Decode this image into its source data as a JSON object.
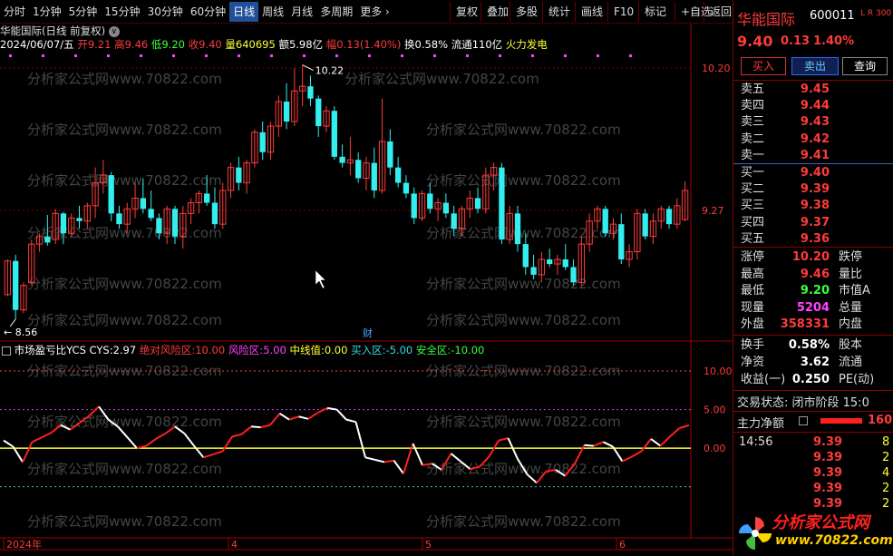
{
  "toolbar": {
    "items": [
      "分时",
      "1分钟",
      "5分钟",
      "15分钟",
      "30分钟",
      "60分钟",
      "日线",
      "周线",
      "月线",
      "多周期",
      "更多 ›"
    ],
    "right_items": [
      "复权",
      "叠加",
      "多股",
      "统计",
      "画线",
      "F10",
      "标记",
      "+自选",
      "返回"
    ]
  },
  "chart_header": {
    "title": "华能国际(日线 前复权)",
    "date": "2024/06/07/五",
    "open_label": "开",
    "open": "9.21",
    "high_label": "高",
    "high": "9.46",
    "low_label": "低",
    "low": "9.20",
    "close_label": "收",
    "close": "9.40",
    "volume_label": "量",
    "volume": "640695",
    "amount_label": "额",
    "amount": "5.98亿",
    "amp_label": "幅",
    "amp": "0.13(1.40%)",
    "turnover_label": "换",
    "turnover": "0.58%",
    "float_label": "流通",
    "float": "110亿",
    "concept": "火力发电"
  },
  "price_axis": {
    "top": "10.20",
    "mid": "9.27"
  },
  "price_annotations": {
    "max": "10.22",
    "min": "8.56",
    "cai": "财"
  },
  "watermark": "分析家公式网www.70822.com",
  "indicator": {
    "name": "市场盈亏比YCS",
    "cys_label": "CYS:",
    "cys": "2.97",
    "abs_risk_label": "绝对风险区:",
    "abs_risk": "10.00",
    "risk_label": "风险区:",
    "risk": "5.00",
    "mid_label": "中线值:",
    "mid": "0.00",
    "buy_label": "买入区:",
    "buy": "-5.00",
    "safe_label": "安全区:",
    "safe": "-10.00",
    "axis": [
      "10.00",
      "5.00",
      "0.00"
    ]
  },
  "time_axis": [
    "2024年",
    "4",
    "5",
    "6"
  ],
  "quote": {
    "name": "华能国际",
    "code": "600011",
    "flags": "L R 300",
    "price": "9.40",
    "change": "0.13",
    "pct": "1.40%",
    "buy_btn": "买入",
    "sell_btn": "卖出",
    "query_btn": "查询",
    "asks": [
      {
        "label": "卖五",
        "price": "9.45"
      },
      {
        "label": "卖四",
        "price": "9.44"
      },
      {
        "label": "卖三",
        "price": "9.43"
      },
      {
        "label": "卖二",
        "price": "9.42"
      },
      {
        "label": "卖一",
        "price": "9.41"
      }
    ],
    "bids": [
      {
        "label": "买一",
        "price": "9.40"
      },
      {
        "label": "买二",
        "price": "9.39"
      },
      {
        "label": "买三",
        "price": "9.38"
      },
      {
        "label": "买四",
        "price": "9.37"
      },
      {
        "label": "买五",
        "price": "9.36"
      }
    ],
    "stats": [
      {
        "label": "涨停",
        "value": "10.20",
        "label2": "跌停"
      },
      {
        "label": "最高",
        "value": "9.46",
        "label2": "量比"
      },
      {
        "label": "最低",
        "value": "9.20",
        "label2": "市值A"
      },
      {
        "label": "现量",
        "value": "5204",
        "label2": "总量"
      },
      {
        "label": "外盘",
        "value": "358331",
        "label2": "内盘"
      }
    ],
    "stats2": [
      {
        "label": "换手",
        "value": "0.58%",
        "label2": "股本"
      },
      {
        "label": "净资",
        "value": "3.62",
        "label2": "流通"
      },
      {
        "label": "收益(一)",
        "value": "0.250",
        "label2": "PE(动)"
      }
    ],
    "trade_status": "交易状态: 闭市阶段 15:0",
    "main_flow_label": "主力净额",
    "main_flow_value": "160",
    "ticks": [
      {
        "time": "14:56",
        "price": "9.39",
        "vol": "8"
      },
      {
        "time": "",
        "price": "9.39",
        "vol": "2"
      },
      {
        "time": "",
        "price": "9.39",
        "vol": "4"
      },
      {
        "time": "",
        "price": "9.39",
        "vol": "2"
      },
      {
        "time": "",
        "price": "9.39",
        "vol": "2"
      }
    ]
  },
  "logo": {
    "text": "分析家公式网",
    "url": "www.70822.com"
  },
  "colors": {
    "up": "#ff3b3b",
    "down": "#33eeee",
    "bg": "#000000",
    "grid": "#880000"
  },
  "chart_data": {
    "type": "candlestick",
    "candles": [
      [
        8.72,
        8.95,
        8.71,
        8.94
      ],
      [
        8.94,
        8.98,
        8.56,
        8.62
      ],
      [
        8.62,
        8.8,
        8.6,
        8.78
      ],
      [
        8.8,
        9.08,
        8.78,
        9.05
      ],
      [
        9.05,
        9.12,
        9.0,
        9.1
      ],
      [
        9.1,
        9.24,
        9.04,
        9.06
      ],
      [
        9.08,
        9.28,
        9.05,
        9.25
      ],
      [
        9.25,
        9.26,
        9.05,
        9.12
      ],
      [
        9.12,
        9.25,
        9.1,
        9.22
      ],
      [
        9.22,
        9.3,
        9.15,
        9.2
      ],
      [
        9.2,
        9.32,
        9.15,
        9.3
      ],
      [
        9.3,
        9.55,
        9.22,
        9.45
      ],
      [
        9.45,
        9.6,
        9.38,
        9.5
      ],
      [
        9.5,
        9.52,
        9.2,
        9.25
      ],
      [
        9.25,
        9.3,
        9.15,
        9.18
      ],
      [
        9.18,
        9.32,
        9.12,
        9.28
      ],
      [
        9.28,
        9.45,
        9.22,
        9.35
      ],
      [
        9.35,
        9.48,
        9.25,
        9.28
      ],
      [
        9.28,
        9.4,
        9.2,
        9.22
      ],
      [
        9.22,
        9.25,
        9.08,
        9.12
      ],
      [
        9.12,
        9.3,
        9.05,
        9.28
      ],
      [
        9.28,
        9.3,
        9.05,
        9.1
      ],
      [
        9.1,
        9.3,
        9.02,
        9.25
      ],
      [
        9.25,
        9.35,
        9.18,
        9.32
      ],
      [
        9.32,
        9.4,
        9.25,
        9.38
      ],
      [
        9.38,
        9.5,
        9.3,
        9.32
      ],
      [
        9.32,
        9.42,
        9.15,
        9.18
      ],
      [
        9.18,
        9.45,
        9.15,
        9.4
      ],
      [
        9.4,
        9.58,
        9.35,
        9.55
      ],
      [
        9.55,
        9.62,
        9.4,
        9.45
      ],
      [
        9.45,
        9.6,
        9.38,
        9.58
      ],
      [
        9.58,
        9.8,
        9.55,
        9.78
      ],
      [
        9.78,
        9.85,
        9.6,
        9.65
      ],
      [
        9.65,
        9.85,
        9.6,
        9.82
      ],
      [
        9.82,
        10.02,
        9.75,
        9.98
      ],
      [
        9.98,
        10.1,
        9.8,
        9.85
      ],
      [
        9.85,
        10.2,
        9.82,
        10.05
      ],
      [
        10.05,
        10.22,
        9.95,
        10.08
      ],
      [
        10.08,
        10.15,
        9.95,
        10.0
      ],
      [
        10.0,
        10.02,
        9.75,
        9.82
      ],
      [
        9.82,
        9.95,
        9.78,
        9.92
      ],
      [
        9.92,
        9.95,
        9.6,
        9.62
      ],
      [
        9.62,
        9.7,
        9.55,
        9.58
      ],
      [
        9.58,
        9.75,
        9.5,
        9.6
      ],
      [
        9.6,
        9.65,
        9.45,
        9.48
      ],
      [
        9.48,
        9.62,
        9.4,
        9.58
      ],
      [
        9.58,
        9.68,
        9.35,
        9.4
      ],
      [
        9.4,
        10.0,
        9.38,
        9.72
      ],
      [
        9.72,
        9.8,
        9.5,
        9.55
      ],
      [
        9.55,
        9.62,
        9.42,
        9.45
      ],
      [
        9.45,
        9.5,
        9.35,
        9.38
      ],
      [
        9.38,
        9.42,
        9.18,
        9.22
      ],
      [
        9.22,
        9.4,
        9.2,
        9.38
      ],
      [
        9.38,
        9.45,
        9.25,
        9.28
      ],
      [
        9.28,
        9.35,
        9.2,
        9.32
      ],
      [
        9.32,
        9.38,
        9.22,
        9.25
      ],
      [
        9.25,
        9.3,
        9.1,
        9.15
      ],
      [
        9.15,
        9.3,
        9.1,
        9.28
      ],
      [
        9.28,
        9.4,
        9.22,
        9.35
      ],
      [
        9.35,
        9.42,
        9.25,
        9.28
      ],
      [
        9.28,
        9.55,
        9.25,
        9.5
      ],
      [
        9.5,
        9.58,
        9.4,
        9.55
      ],
      [
        9.55,
        9.58,
        9.05,
        9.08
      ],
      [
        9.08,
        9.3,
        9.05,
        9.25
      ],
      [
        9.25,
        9.3,
        9.0,
        9.05
      ],
      [
        9.05,
        9.12,
        8.85,
        8.9
      ],
      [
        8.9,
        8.98,
        8.82,
        8.85
      ],
      [
        8.85,
        9.0,
        8.8,
        8.95
      ],
      [
        8.95,
        9.02,
        8.9,
        8.92
      ],
      [
        8.92,
        8.98,
        8.85,
        8.95
      ],
      [
        8.95,
        9.05,
        8.88,
        8.9
      ],
      [
        8.9,
        8.95,
        8.78,
        8.8
      ],
      [
        8.8,
        9.1,
        8.78,
        9.05
      ],
      [
        9.05,
        9.25,
        9.0,
        9.2
      ],
      [
        9.2,
        9.3,
        9.15,
        9.28
      ],
      [
        9.28,
        9.3,
        9.1,
        9.12
      ],
      [
        9.12,
        9.22,
        9.08,
        9.18
      ],
      [
        9.18,
        9.25,
        8.92,
        8.95
      ],
      [
        8.95,
        9.05,
        8.9,
        9.0
      ],
      [
        9.0,
        9.28,
        8.95,
        9.25
      ],
      [
        9.25,
        9.28,
        9.08,
        9.1
      ],
      [
        9.1,
        9.25,
        9.05,
        9.2
      ],
      [
        9.2,
        9.3,
        9.15,
        9.28
      ],
      [
        9.28,
        9.3,
        9.15,
        9.18
      ],
      [
        9.18,
        9.35,
        9.15,
        9.3
      ],
      [
        9.21,
        9.46,
        9.2,
        9.4
      ]
    ],
    "cys_values": [
      1.0,
      0.2,
      -1.8,
      0.8,
      1.4,
      2.0,
      3.0,
      2.4,
      3.3,
      4.2,
      5.4,
      3.7,
      2.8,
      1.4,
      0.0,
      0.3,
      1.2,
      1.9,
      2.8,
      1.9,
      0.3,
      -1.2,
      -0.8,
      -0.4,
      1.5,
      1.8,
      2.8,
      2.7,
      3.0,
      4.5,
      3.7,
      4.1,
      3.8,
      4.6,
      5.2,
      5.0,
      3.7,
      3.4,
      -1.2,
      -1.5,
      -1.8,
      -1.6,
      -3.3,
      0.6,
      -2.2,
      -2.0,
      -2.8,
      -0.7,
      -1.7,
      -2.7,
      -2.4,
      -1.1,
      1.0,
      1.3,
      -1.4,
      -3.4,
      -4.5,
      -3.0,
      -2.8,
      -3.6,
      -2.0,
      0.4,
      0.3,
      0.8,
      0.2,
      -1.7,
      -1.1,
      -0.4,
      1.2,
      0.3,
      1.5,
      2.6,
      2.97
    ],
    "price_ylim": [
      8.5,
      10.3
    ],
    "cys_ylim": [
      -11.5,
      12.0
    ]
  }
}
